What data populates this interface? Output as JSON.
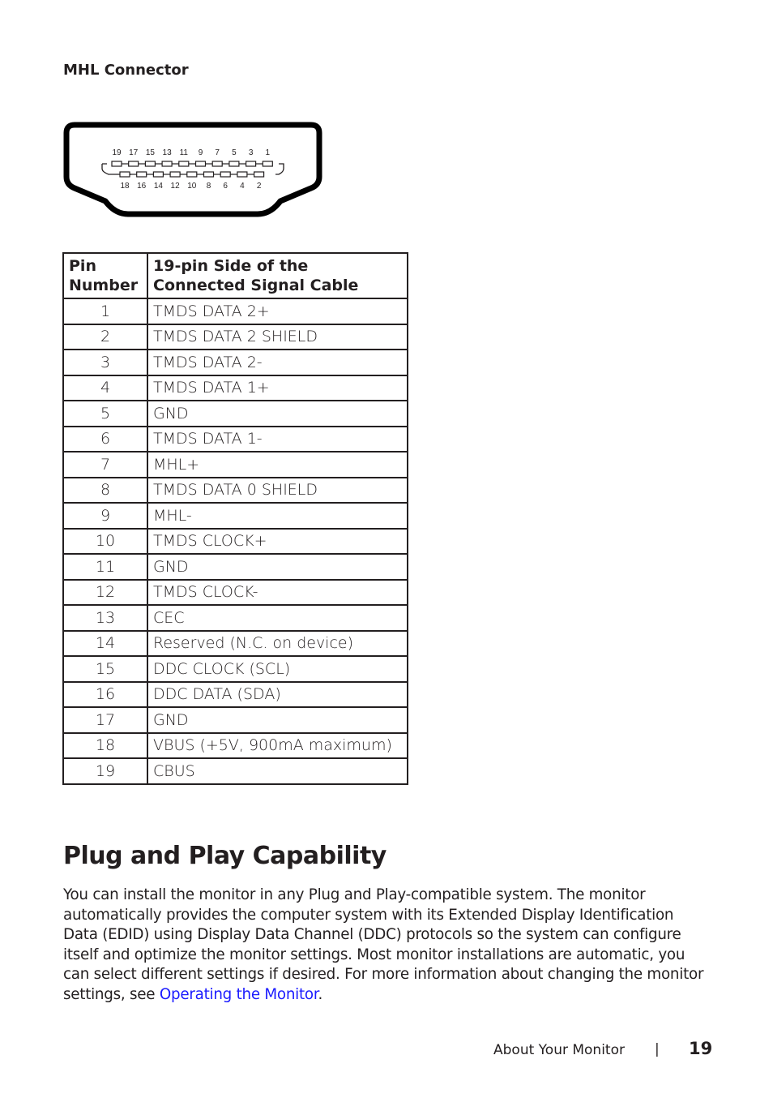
{
  "section_label": "MHL Connector",
  "connector_diagram": {
    "top_row_pins": [
      "19",
      "17",
      "15",
      "13",
      "11",
      "9",
      "7",
      "5",
      "3",
      "1"
    ],
    "bottom_row_pins": [
      "18",
      "16",
      "14",
      "12",
      "10",
      "8",
      "6",
      "4",
      "2"
    ]
  },
  "table": {
    "headers": [
      "Pin Number",
      "19-pin Side of the Connected Signal Cable"
    ],
    "rows": [
      {
        "pin": "1",
        "signal": "TMDS DATA 2+"
      },
      {
        "pin": "2",
        "signal": "TMDS DATA 2 SHIELD"
      },
      {
        "pin": "3",
        "signal": "TMDS DATA 2-"
      },
      {
        "pin": "4",
        "signal": "TMDS DATA 1+"
      },
      {
        "pin": "5",
        "signal": "GND"
      },
      {
        "pin": "6",
        "signal": "TMDS DATA 1-"
      },
      {
        "pin": "7",
        "signal": "MHL+"
      },
      {
        "pin": "8",
        "signal": "TMDS DATA 0 SHIELD"
      },
      {
        "pin": "9",
        "signal": "MHL-"
      },
      {
        "pin": "10",
        "signal": "TMDS CLOCK+"
      },
      {
        "pin": "11",
        "signal": "GND"
      },
      {
        "pin": "12",
        "signal": "TMDS CLOCK-"
      },
      {
        "pin": "13",
        "signal": "CEC"
      },
      {
        "pin": "14",
        "signal": "Reserved (N.C. on device)"
      },
      {
        "pin": "15",
        "signal": "DDC CLOCK (SCL)"
      },
      {
        "pin": "16",
        "signal": "DDC DATA (SDA)"
      },
      {
        "pin": "17",
        "signal": "GND"
      },
      {
        "pin": "18",
        "signal": "VBUS (+5V, 900mA maximum)"
      },
      {
        "pin": "19",
        "signal": "CBUS"
      }
    ]
  },
  "plug_and_play": {
    "heading": "Plug and Play Capability",
    "body": "You can install the monitor in any Plug and Play-compatible system. The monitor automatically provides the computer system with its Extended Display Identification Data (EDID) using Display Data Channel (DDC) protocols so the system can configure itself and optimize the monitor settings. Most monitor installations are automatic, you can select different settings if desired. For more information about changing the monitor settings, see ",
    "link_text": "Operating the Monitor",
    "trailing": ".",
    "link_color": "#1a1aff"
  },
  "footer": {
    "section_title": "About Your Monitor",
    "separator": "|",
    "page_number": "19"
  }
}
